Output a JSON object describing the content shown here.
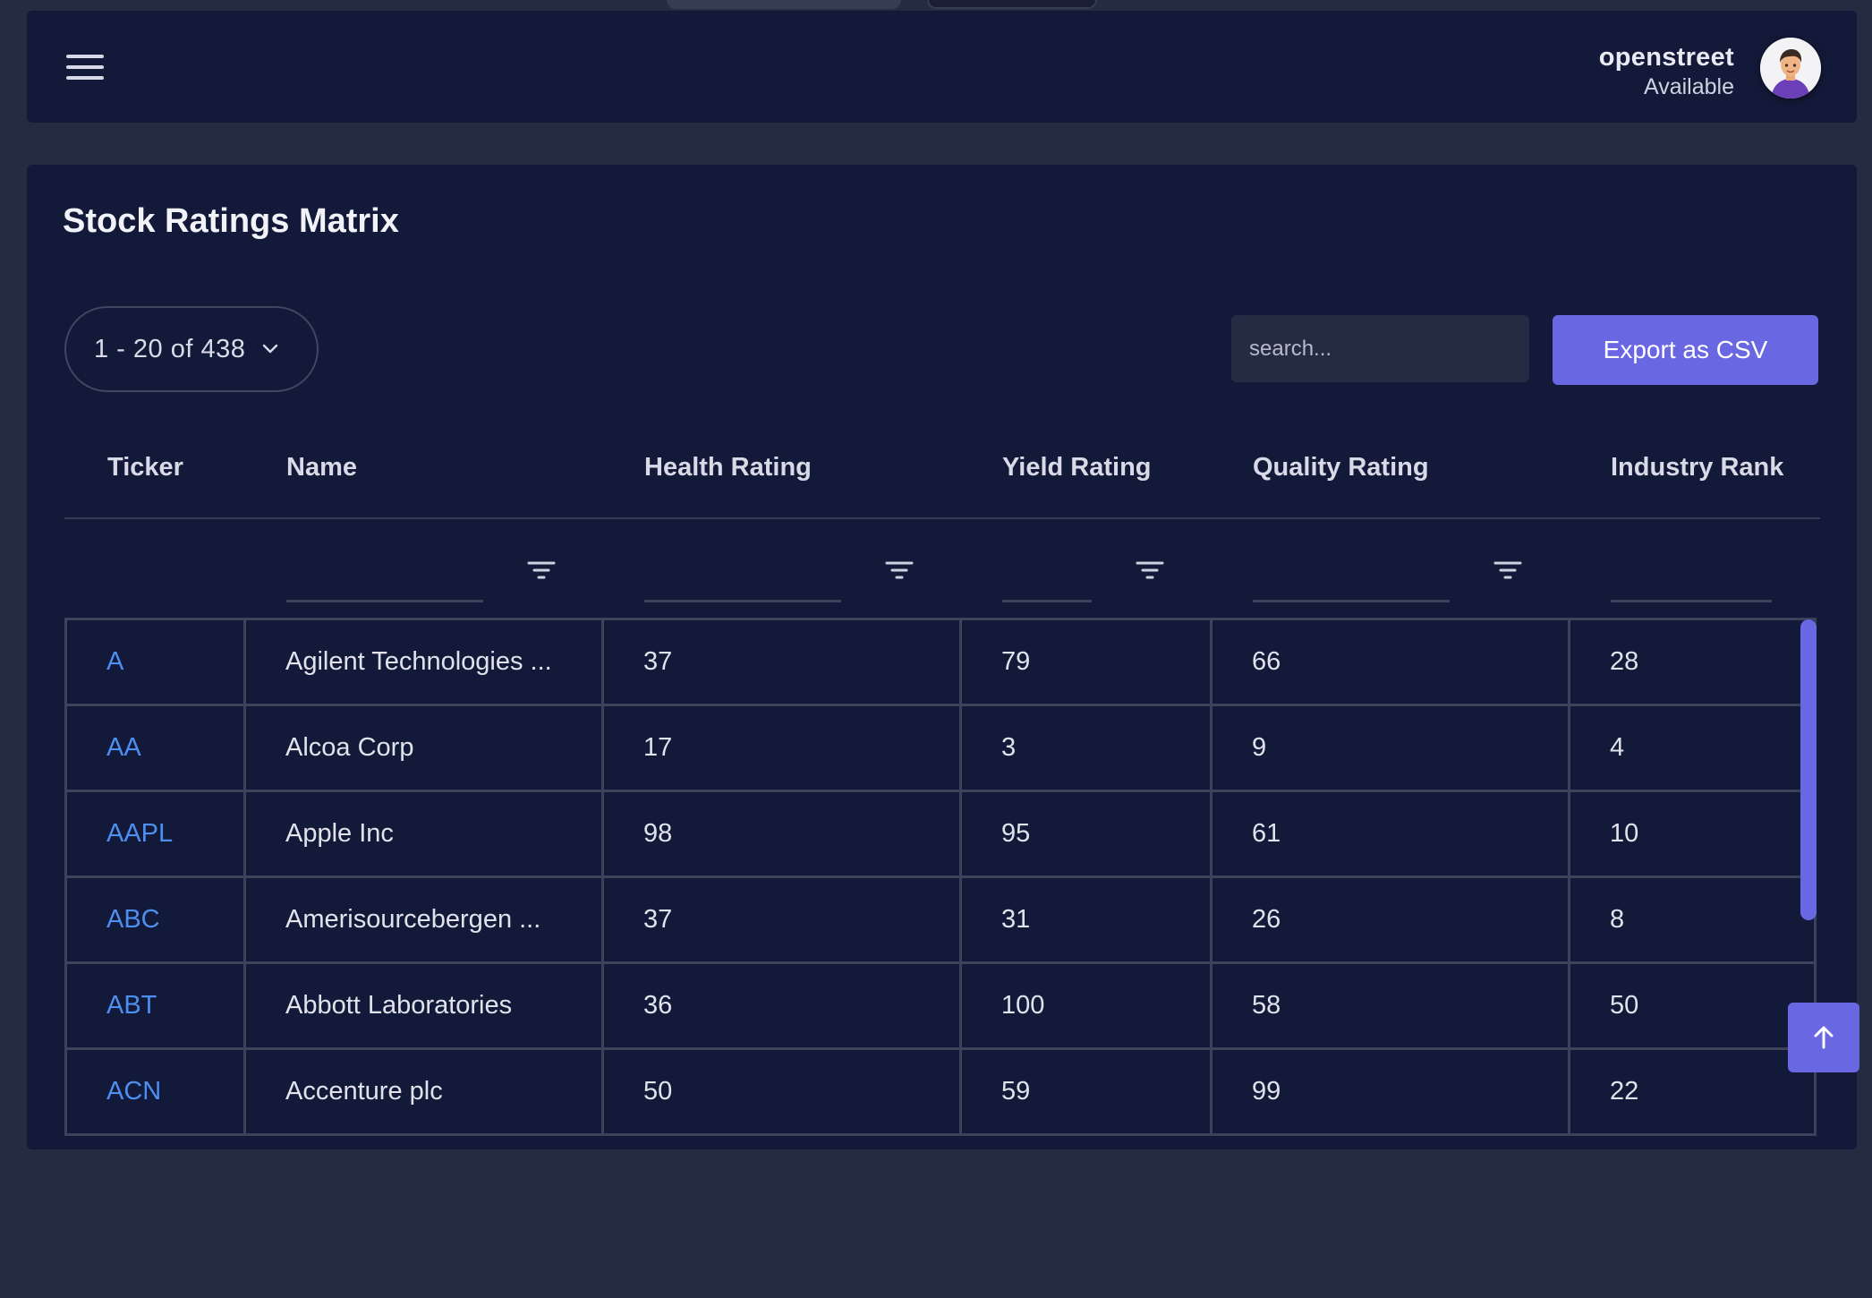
{
  "header": {
    "username": "openstreet",
    "status": "Available"
  },
  "page": {
    "title": "Stock Ratings Matrix"
  },
  "toolbar": {
    "pager_label": "1 - 20 of 438",
    "search_placeholder": "search...",
    "export_label": "Export as CSV"
  },
  "table": {
    "columns": [
      "Ticker",
      "Name",
      "Health Rating",
      "Yield Rating",
      "Quality Rating",
      "Industry Rank"
    ],
    "rows": [
      {
        "ticker": "A",
        "name": "Agilent Technologies ...",
        "health": "37",
        "yield": "79",
        "quality": "66",
        "rank": "28"
      },
      {
        "ticker": "AA",
        "name": "Alcoa Corp",
        "health": "17",
        "yield": "3",
        "quality": "9",
        "rank": "4"
      },
      {
        "ticker": "AAPL",
        "name": "Apple Inc",
        "health": "98",
        "yield": "95",
        "quality": "61",
        "rank": "10"
      },
      {
        "ticker": "ABC",
        "name": "Amerisourcebergen ...",
        "health": "37",
        "yield": "31",
        "quality": "26",
        "rank": "8"
      },
      {
        "ticker": "ABT",
        "name": "Abbott Laboratories",
        "health": "36",
        "yield": "100",
        "quality": "58",
        "rank": "50"
      },
      {
        "ticker": "ACN",
        "name": "Accenture plc",
        "health": "50",
        "yield": "59",
        "quality": "99",
        "rank": "22"
      }
    ]
  },
  "icons": {
    "menu": "hamburger-menu-icon",
    "filter": "filter-icon",
    "chevron": "chevron-down-icon",
    "back_to_top": "arrow-up-icon"
  },
  "colors": {
    "background": "#252b40",
    "panel": "#131938",
    "accent": "#6a67e3",
    "link": "#4d8ff0",
    "grid_line": "#3b4259"
  }
}
